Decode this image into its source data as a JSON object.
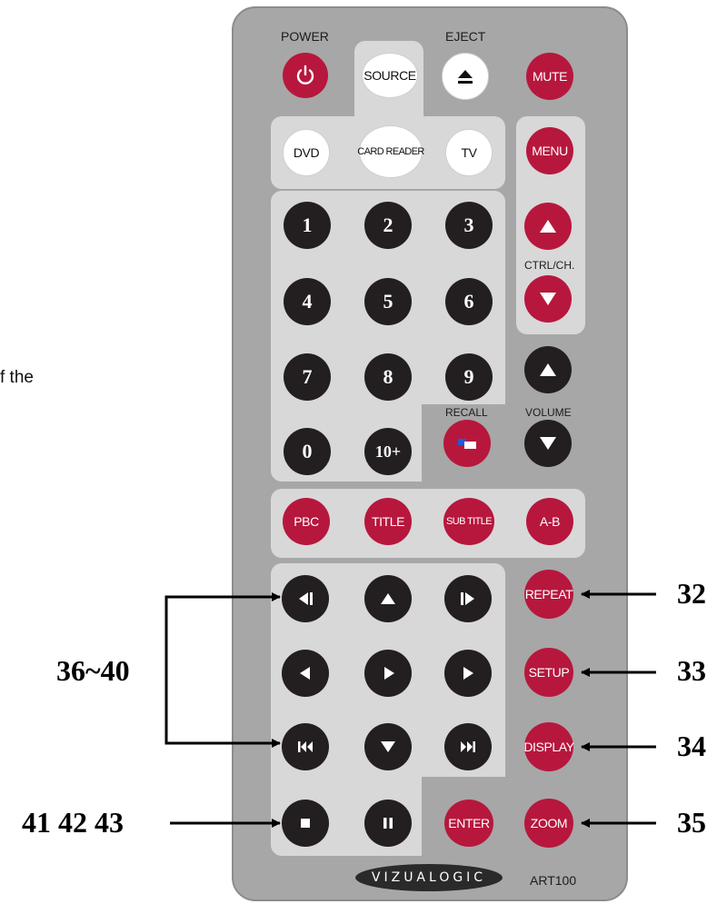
{
  "side_text": "f the",
  "remote": {
    "labels": {
      "power": "POWER",
      "eject": "EJECT",
      "ctrl_ch": "CTRL/CH.",
      "recall": "RECALL",
      "volume": "VOLUME"
    },
    "buttons": {
      "source": "SOURCE",
      "mute": "MUTE",
      "dvd": "DVD",
      "card_reader": "CARD READER",
      "tv": "TV",
      "menu": "MENU",
      "digits": [
        "1",
        "2",
        "3",
        "4",
        "5",
        "6",
        "7",
        "8",
        "9",
        "0",
        "10+"
      ],
      "pbc": "PBC",
      "title": "TITLE",
      "sub_title": "SUB TITLE",
      "a_b": "A-B",
      "repeat": "REPEAT",
      "setup": "SETUP",
      "display": "DISPLAY",
      "enter": "ENTER",
      "zoom": "ZOOM"
    },
    "brand": "VIZUALOGIC",
    "model": "ART100"
  },
  "callouts": {
    "repeat": "32",
    "setup": "33",
    "display": "34",
    "zoom": "35",
    "nav_group": "36~40",
    "stop_group": "41 42 43"
  },
  "colors": {
    "body": "#a7a7a7",
    "panel": "#d8d8d8",
    "black_button": "#231f20",
    "red_button": "#b7173d",
    "white_button": "#ffffff"
  }
}
